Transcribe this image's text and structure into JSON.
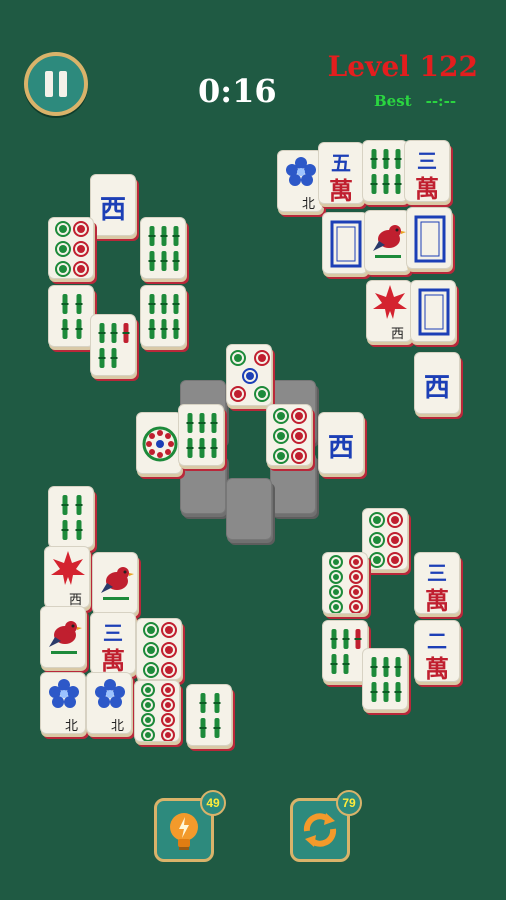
{
  "hud": {
    "timer": "0:16",
    "level": "Level 122",
    "best_label": "Best",
    "best_value": "--:--"
  },
  "tools": {
    "hint_count": "49",
    "shuffle_count": "79"
  },
  "colors": {
    "background": "#1f5a43",
    "accent": "#2d8a7d",
    "gold": "#d9b36a",
    "level_red": "#e31e1e",
    "best_green": "#2ad640"
  },
  "tiles": [
    {
      "name": "tile-west-1",
      "kind": "char",
      "text": "西",
      "color": "#1c3fb6"
    },
    {
      "name": "tile-circle-6-1",
      "kind": "circles",
      "n": 6
    },
    {
      "name": "tile-bamboo-6-1",
      "kind": "bamboo",
      "n": 6
    },
    {
      "name": "tile-bamboo-4-1",
      "kind": "bamboo",
      "n": 4
    },
    {
      "name": "tile-bamboo-5-1",
      "kind": "bamboo",
      "n": 5
    },
    {
      "name": "tile-bamboo-6-2",
      "kind": "bamboo",
      "n": 6
    },
    {
      "name": "tile-flower-north-1",
      "kind": "flower",
      "sub": "北"
    },
    {
      "name": "tile-5-wan",
      "kind": "wan",
      "top": "五",
      "bottom": "萬"
    },
    {
      "name": "tile-bamboo-6-3",
      "kind": "bamboo",
      "n": 6
    },
    {
      "name": "tile-3-wan-1",
      "kind": "wan",
      "top": "三",
      "bottom": "萬"
    },
    {
      "name": "tile-white-dragon-1",
      "kind": "frame"
    },
    {
      "name": "tile-bird-1",
      "kind": "bird"
    },
    {
      "name": "tile-white-dragon-2",
      "kind": "frame"
    },
    {
      "name": "tile-maple-west-1",
      "kind": "maple",
      "sub": "西"
    },
    {
      "name": "tile-white-dragon-3",
      "kind": "frame"
    },
    {
      "name": "tile-west-2",
      "kind": "char",
      "text": "西",
      "color": "#1c3fb6"
    },
    {
      "name": "tile-circle-5-center",
      "kind": "circles",
      "n": 5
    },
    {
      "name": "tile-wheel",
      "kind": "wheel"
    },
    {
      "name": "tile-bamboo-6-center",
      "kind": "bamboo",
      "n": 6
    },
    {
      "name": "tile-circle-6-center",
      "kind": "circles",
      "n": 6
    },
    {
      "name": "tile-west-3",
      "kind": "char",
      "text": "西",
      "color": "#1c3fb6"
    },
    {
      "name": "tile-bamboo-4-2",
      "kind": "bamboo",
      "n": 4
    },
    {
      "name": "tile-maple-west-2",
      "kind": "maple",
      "sub": "西"
    },
    {
      "name": "tile-bird-2",
      "kind": "bird"
    },
    {
      "name": "tile-bird-3",
      "kind": "bird"
    },
    {
      "name": "tile-3-wan-2",
      "kind": "wan",
      "top": "三",
      "bottom": "萬"
    },
    {
      "name": "tile-circle-6-2",
      "kind": "circles",
      "n": 6
    },
    {
      "name": "tile-flower-north-2",
      "kind": "flower",
      "sub": "北"
    },
    {
      "name": "tile-flower-north-3",
      "kind": "flower",
      "sub": "北"
    },
    {
      "name": "tile-circle-8-1",
      "kind": "circles",
      "n": 8
    },
    {
      "name": "tile-bamboo-4-3",
      "kind": "bamboo",
      "n": 4
    },
    {
      "name": "tile-circle-6-3",
      "kind": "circles",
      "n": 6
    },
    {
      "name": "tile-circle-8-2",
      "kind": "circles",
      "n": 8
    },
    {
      "name": "tile-3-wan-3",
      "kind": "wan",
      "top": "三",
      "bottom": "萬"
    },
    {
      "name": "tile-bamboo-5-2",
      "kind": "bamboo",
      "n": 5
    },
    {
      "name": "tile-bamboo-6-4",
      "kind": "bamboo",
      "n": 6
    },
    {
      "name": "tile-2-wan",
      "kind": "wan",
      "top": "二",
      "bottom": "萬"
    }
  ]
}
